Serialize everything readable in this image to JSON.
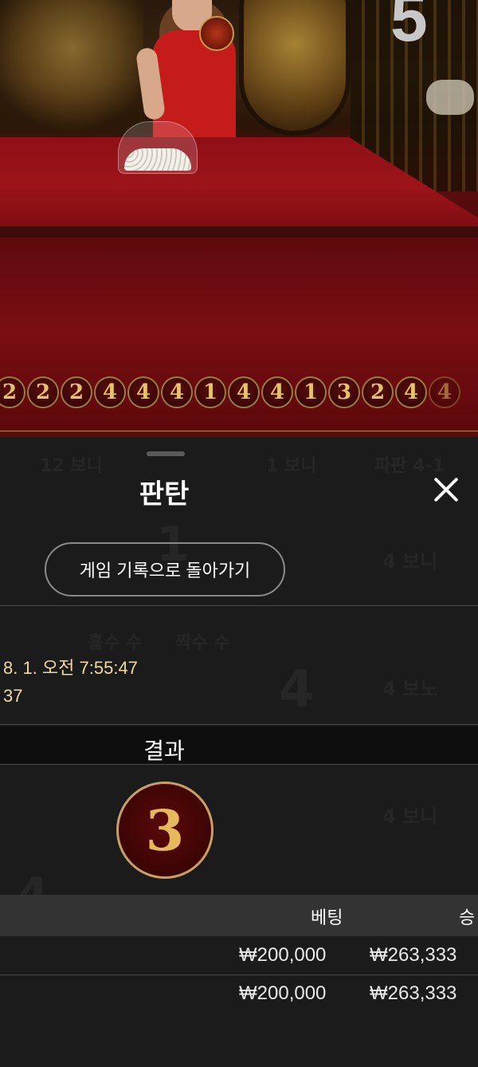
{
  "video": {
    "round_number": "5",
    "history": [
      "2",
      "2",
      "2",
      "4",
      "4",
      "4",
      "1",
      "4",
      "4",
      "1",
      "3",
      "2",
      "4",
      "4"
    ]
  },
  "sheet": {
    "title": "판탄",
    "back_button": "게임 기록으로 돌아가기",
    "datetime_partial": "8. 1. 오전 7:55:47",
    "id_partial": "37",
    "result_label": "결과",
    "result_value": "3",
    "table": {
      "headers": [
        "베팅",
        "승"
      ],
      "rows": [
        {
          "bet": "₩200,000",
          "win": "₩263,333"
        },
        {
          "bet": "₩200,000",
          "win": "₩263,333"
        }
      ]
    },
    "background_ghosts": [
      "1",
      "4",
      "4",
      "4 보니",
      "4 보노",
      "4 보니",
      "홀수 수",
      "짝수 수",
      "1 보니",
      "파판 4-1",
      "12 보니"
    ]
  }
}
